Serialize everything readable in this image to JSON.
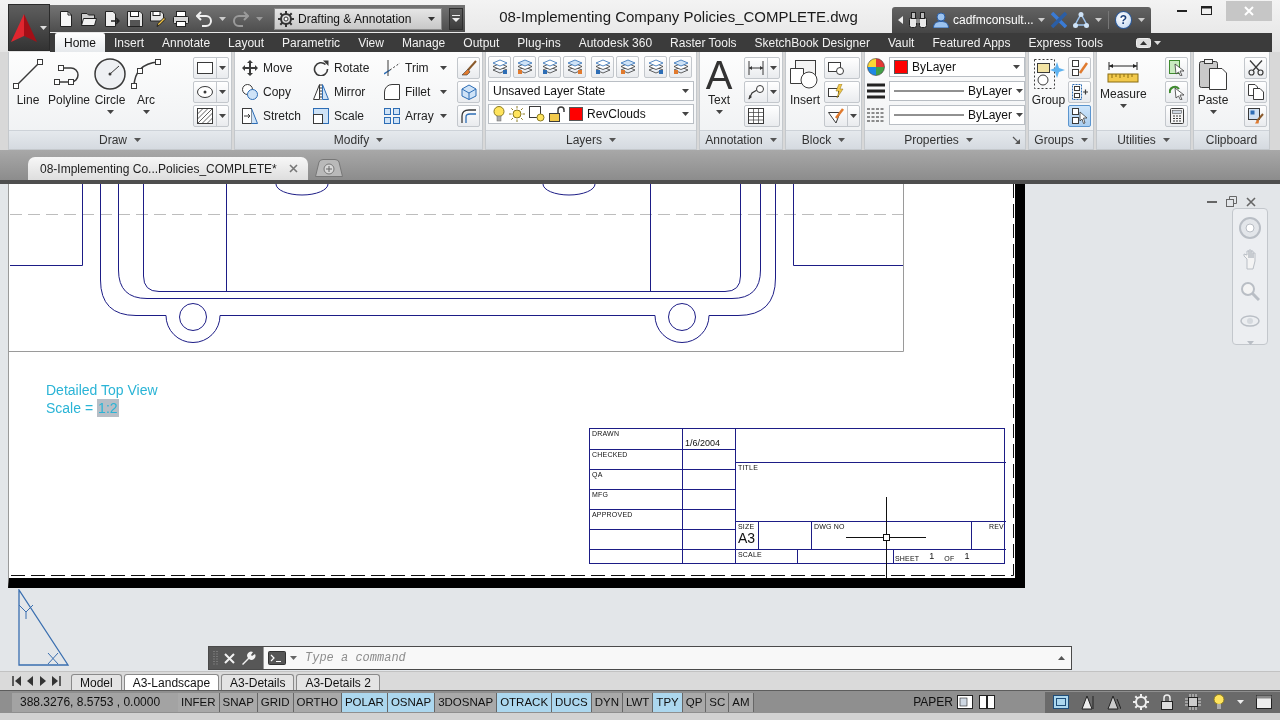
{
  "quick_access": {
    "workspace": "Drafting & Annotation"
  },
  "window": {
    "title": "08-Implementing Company Policies_COMPLETE.dwg"
  },
  "infocenter": {
    "user": "cadfmconsult...",
    "help": "?"
  },
  "ribbon_tabs": [
    {
      "label": "Home",
      "selected": true
    },
    {
      "label": "Insert",
      "selected": false
    },
    {
      "label": "Annotate",
      "selected": false
    },
    {
      "label": "Layout",
      "selected": false
    },
    {
      "label": "Parametric",
      "selected": false
    },
    {
      "label": "View",
      "selected": false
    },
    {
      "label": "Manage",
      "selected": false
    },
    {
      "label": "Output",
      "selected": false
    },
    {
      "label": "Plug-ins",
      "selected": false
    },
    {
      "label": "Autodesk 360",
      "selected": false
    },
    {
      "label": "Raster Tools",
      "selected": false
    },
    {
      "label": "SketchBook Designer",
      "selected": false
    },
    {
      "label": "Vault",
      "selected": false
    },
    {
      "label": "Featured Apps",
      "selected": false
    },
    {
      "label": "Express Tools",
      "selected": false
    }
  ],
  "ribbon_panels": [
    {
      "kind": "draw",
      "title": "Draw",
      "expandable": true,
      "large_tools": [
        {
          "label": "Line",
          "menu": false
        },
        {
          "label": "Polyline",
          "menu": false
        },
        {
          "label": "Circle",
          "menu": true
        },
        {
          "label": "Arc",
          "menu": true
        }
      ]
    },
    {
      "kind": "modify",
      "title": "Modify",
      "expandable": true,
      "tools": [
        {
          "label": "Move",
          "menu": false
        },
        {
          "label": "Rotate",
          "menu": false
        },
        {
          "label": "Trim",
          "menu": true
        },
        {
          "label": "Copy",
          "menu": false
        },
        {
          "label": "Mirror",
          "menu": false
        },
        {
          "label": "Fillet",
          "menu": true
        },
        {
          "label": "Stretch",
          "menu": false
        },
        {
          "label": "Scale",
          "menu": false
        },
        {
          "label": "Array",
          "menu": true
        }
      ]
    },
    {
      "kind": "layers",
      "title": "Layers",
      "expandable": true,
      "layer_state": "Unsaved Layer State",
      "layer": {
        "name": "RevClouds",
        "color": "#ff0000"
      }
    },
    {
      "kind": "annotation",
      "title": "Annotation",
      "expandable": true,
      "large_tools": [
        {
          "glyph": "A",
          "label": "Text",
          "menu": true
        }
      ]
    },
    {
      "kind": "block",
      "title": "Block",
      "expandable": true,
      "large_tools": [
        {
          "label": "Insert",
          "menu": false
        }
      ]
    },
    {
      "kind": "properties",
      "title": "Properties",
      "expandable": true,
      "launcher": true,
      "color": {
        "label": "ByLayer",
        "color": "#ff0000"
      },
      "lineweight": "ByLayer",
      "linetype": "ByLayer"
    },
    {
      "kind": "groups",
      "title": "Groups",
      "expandable": true,
      "large_tools": [
        {
          "label": "Group",
          "menu": false
        }
      ],
      "small_tools": [
        {
          "on": false
        },
        {
          "on": false
        },
        {
          "on": true
        }
      ]
    },
    {
      "kind": "utilities",
      "title": "Utilities",
      "expandable": true,
      "large_tools": [
        {
          "label": "Measure",
          "menu": true
        }
      ]
    },
    {
      "kind": "clipboard",
      "title": "Clipboard",
      "expandable": false,
      "large_tools": [
        {
          "label": "Paste",
          "menu": true
        }
      ]
    }
  ],
  "file_tabs": [
    {
      "label": "08-Implementing Co...Policies_COMPLETE*",
      "selected": true
    }
  ],
  "drawing": {
    "view_title": "Detailed Top View",
    "scale_label": "Scale =",
    "scale_value": "1:2",
    "scale_value_selected": true,
    "title_block": {
      "rows": [
        {
          "label": "DRAWN",
          "value": "1/6/2004"
        },
        {
          "label": "CHECKED"
        },
        {
          "label": "QA"
        },
        {
          "label": "MFG"
        },
        {
          "label": "APPROVED"
        }
      ],
      "title_label": "TITLE",
      "size_label": "SIZE",
      "size": "A3",
      "dwg_no_label": "DWG NO",
      "rev_label": "REV",
      "scale_label": "SCALE",
      "sheet_label": "SHEET",
      "sheet": "1",
      "of_label": "OF",
      "sheet_count": "1"
    }
  },
  "command_line": {
    "placeholder": "Type a command"
  },
  "layout_tabs": [
    {
      "label": "Model",
      "selected": false
    },
    {
      "label": "A3-Landscape",
      "selected": true
    },
    {
      "label": "A3-Details",
      "selected": false
    },
    {
      "label": "A3-Details 2",
      "selected": false
    }
  ],
  "status_bar": {
    "coordinates": "388.3276, 8.5753 , 0.0000",
    "toggles": [
      {
        "label": "INFER",
        "on": false
      },
      {
        "label": "SNAP",
        "on": false
      },
      {
        "label": "GRID",
        "on": false
      },
      {
        "label": "ORTHO",
        "on": false
      },
      {
        "label": "POLAR",
        "on": true
      },
      {
        "label": "OSNAP",
        "on": true
      },
      {
        "label": "3DOSNAP",
        "on": false
      },
      {
        "label": "OTRACK",
        "on": true
      },
      {
        "label": "DUCS",
        "on": true
      },
      {
        "label": "DYN",
        "on": false
      },
      {
        "label": "LWT",
        "on": false
      },
      {
        "label": "TPY",
        "on": true
      },
      {
        "label": "QP",
        "on": false
      },
      {
        "label": "SC",
        "on": false
      },
      {
        "label": "AM",
        "on": false
      }
    ],
    "space": "PAPER"
  }
}
